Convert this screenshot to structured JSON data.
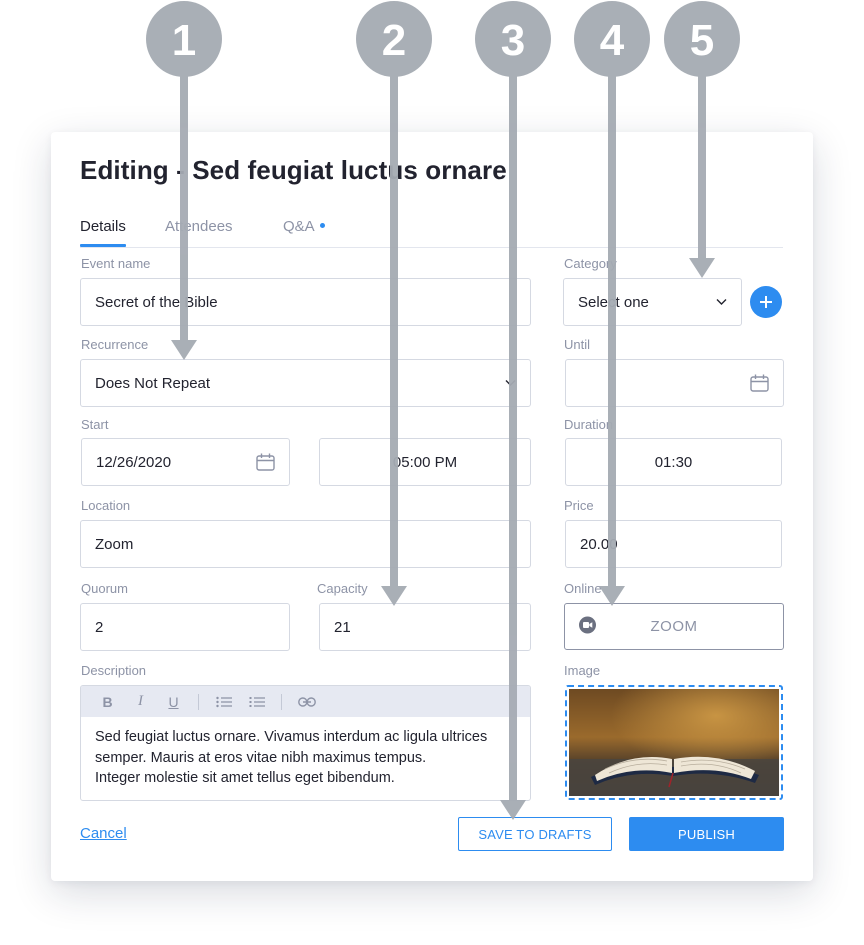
{
  "dialog": {
    "title": "Editing - Sed feugiat luctus ornare",
    "tabs": [
      {
        "label": "Details"
      },
      {
        "label": "Attendees"
      },
      {
        "label": "Q&A"
      }
    ]
  },
  "form": {
    "event_name": {
      "label": "Event name",
      "value": "Secret of the Bible"
    },
    "recurrence": {
      "label": "Recurrence",
      "value": "Does Not Repeat"
    },
    "start": {
      "label": "Start",
      "date": "12/26/2020",
      "time": "05:00 PM"
    },
    "location": {
      "label": "Location",
      "value": "Zoom"
    },
    "quorum": {
      "label": "Quorum",
      "value": "2"
    },
    "capacity": {
      "label": "Capacity",
      "value": "21"
    },
    "description": {
      "label": "Description",
      "toolbar": {
        "bold": "B",
        "italic": "I",
        "underline": "U"
      },
      "lines": [
        "Sed feugiat luctus ornare. Vivamus interdum ac ligula ultrices",
        "semper. Mauris at eros vitae nibh maximus tempus.",
        "Integer molestie sit amet tellus eget bibendum."
      ]
    },
    "category": {
      "label": "Category",
      "placeholder": "Select one"
    },
    "until": {
      "label": "Until",
      "value": ""
    },
    "duration": {
      "label": "Duration",
      "value": "01:30"
    },
    "price": {
      "label": "Price",
      "value": "20.00"
    },
    "online": {
      "label": "Online",
      "button": "ZOOM"
    },
    "image": {
      "label": "Image"
    }
  },
  "footer": {
    "cancel": "Cancel",
    "save_drafts": "SAVE TO DRAFTS",
    "publish": "PUBLISH"
  },
  "callouts": [
    "1",
    "2",
    "3",
    "4",
    "5"
  ],
  "colors": {
    "accent": "#2d8cf0",
    "callout": "#a5abb3",
    "text": "#22232f",
    "muted": "#8d93a6"
  }
}
